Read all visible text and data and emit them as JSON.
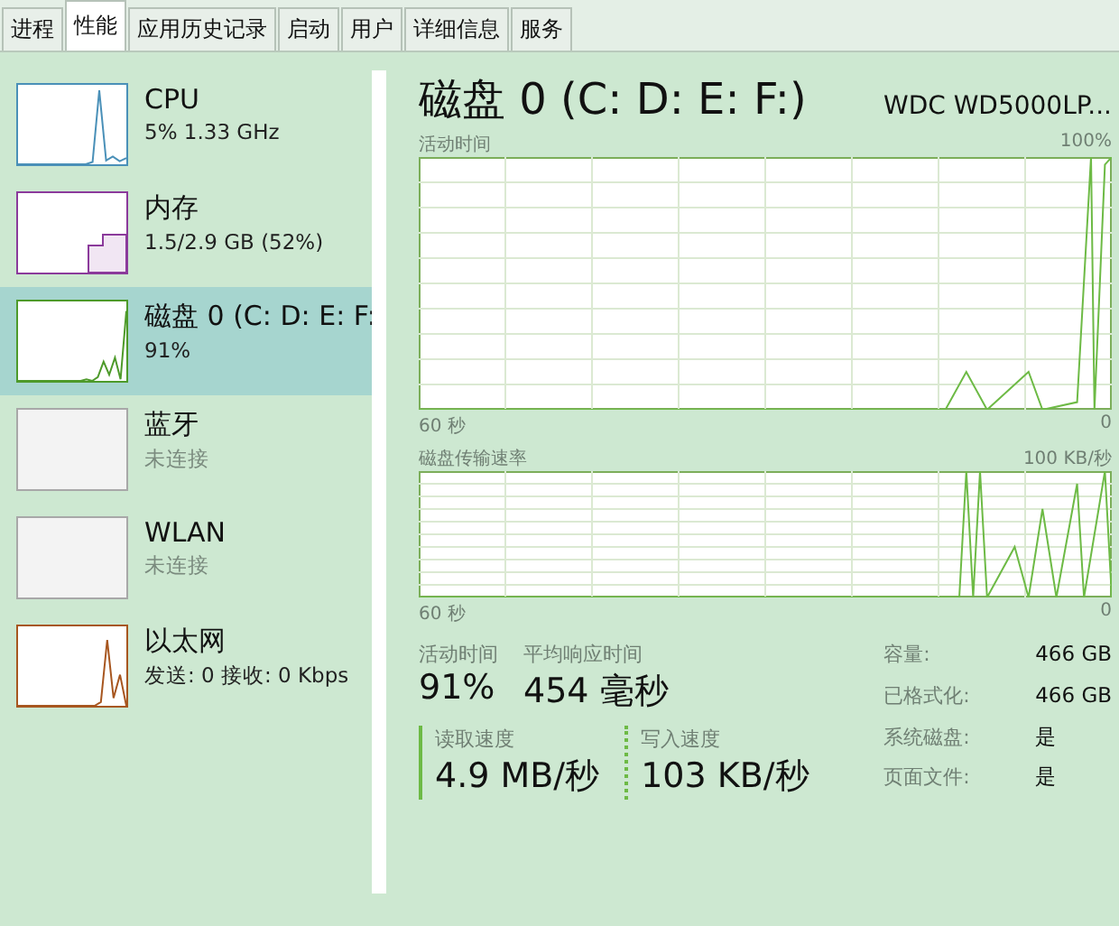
{
  "tabs": [
    {
      "label": "进程",
      "selected": false
    },
    {
      "label": "性能",
      "selected": true
    },
    {
      "label": "应用历史记录",
      "selected": false
    },
    {
      "label": "启动",
      "selected": false
    },
    {
      "label": "用户",
      "selected": false
    },
    {
      "label": "详细信息",
      "selected": false
    },
    {
      "label": "服务",
      "selected": false
    }
  ],
  "sidebar": {
    "items": [
      {
        "name": "CPU",
        "detail": "5% 1.33 GHz",
        "kind": "graph",
        "color": "#4a90b8",
        "selected": false
      },
      {
        "name": "内存",
        "detail": "1.5/2.9 GB (52%)",
        "kind": "memory",
        "color": "#8b3a9b",
        "selected": false
      },
      {
        "name": "磁盘 0 (C: D: E: F:",
        "detail": "91%",
        "kind": "graph",
        "color": "#4d9a2a",
        "selected": true
      },
      {
        "name": "蓝牙",
        "detail": "未连接",
        "kind": "empty",
        "color": "#a8a8a8",
        "selected": false
      },
      {
        "name": "WLAN",
        "detail": "未连接",
        "kind": "empty",
        "color": "#a8a8a8",
        "selected": false
      },
      {
        "name": "以太网",
        "detail": "发送: 0 接收: 0 Kbps",
        "kind": "graph",
        "color": "#a7561f",
        "selected": false
      }
    ]
  },
  "main": {
    "title": "磁盘 0 (C: D: E: F:)",
    "model": "WDC WD5000LP...",
    "charts": [
      {
        "label": "活动时间",
        "max": "100%",
        "start": "60 秒",
        "end": "0"
      },
      {
        "label": "磁盘传输速率",
        "max": "100 KB/秒",
        "start": "60 秒",
        "end": "0"
      }
    ],
    "stats": [
      {
        "label": "活动时间",
        "value": "91%"
      },
      {
        "label": "平均响应时间",
        "value": "454 毫秒"
      }
    ],
    "speeds": [
      {
        "label": "读取速度",
        "value": "4.9 MB/秒",
        "kind": "solid"
      },
      {
        "label": "写入速度",
        "value": "103 KB/秒",
        "kind": "dotted"
      }
    ],
    "properties": [
      {
        "label": "容量:",
        "value": "466 GB"
      },
      {
        "label": "已格式化:",
        "value": "466 GB"
      },
      {
        "label": "系统磁盘:",
        "value": "是"
      },
      {
        "label": "页面文件:",
        "value": "是"
      }
    ]
  }
}
